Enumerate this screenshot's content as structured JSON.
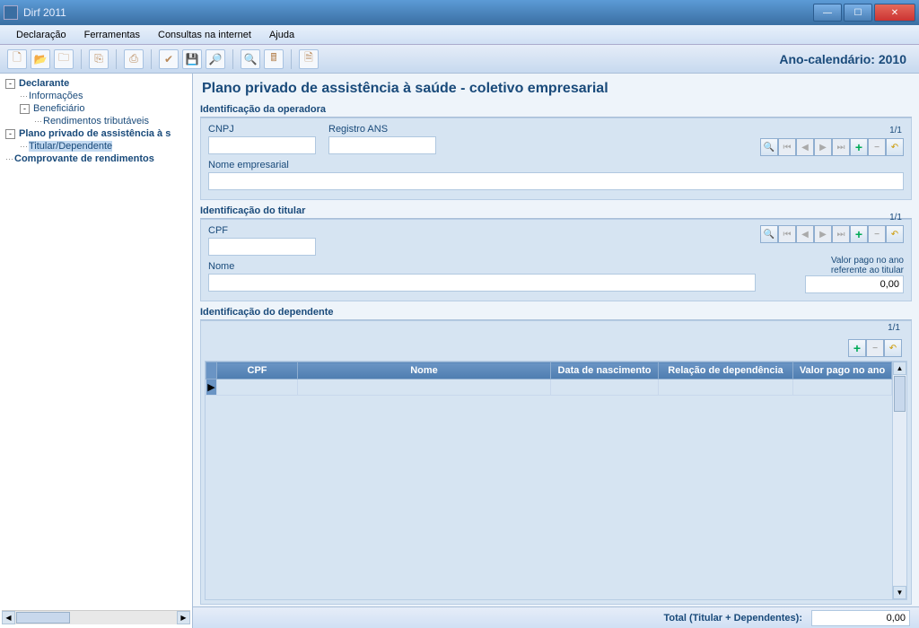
{
  "window": {
    "title": "Dirf 2011"
  },
  "menubar": [
    "Declaração",
    "Ferramentas",
    "Consultas na internet",
    "Ajuda"
  ],
  "toolbar": {
    "icons": [
      "new",
      "open",
      "folder",
      "copy",
      "print",
      "check",
      "save",
      "find",
      "zoom",
      "calc",
      "doc"
    ],
    "year_label": "Ano-calendário: 2010"
  },
  "tree": [
    {
      "level": 1,
      "label": "Declarante",
      "bold": true,
      "exp": "-"
    },
    {
      "level": 2,
      "label": "Informações",
      "bold": false
    },
    {
      "level": 2,
      "label": "Beneficiário",
      "bold": false,
      "exp": "-"
    },
    {
      "level": 3,
      "label": "Rendimentos tributáveis",
      "bold": false
    },
    {
      "level": 1,
      "label": "Plano privado de assistência à s",
      "bold": true,
      "exp": "-"
    },
    {
      "level": 2,
      "label": "Titular/Dependente",
      "bold": false,
      "selected": true
    },
    {
      "level": 1,
      "label": "Comprovante de rendimentos",
      "bold": true
    }
  ],
  "page": {
    "title": "Plano privado de assistência à saúde - coletivo empresarial"
  },
  "operadora": {
    "title": "Identificação da operadora",
    "cnpj_label": "CNPJ",
    "cnpj_value": "",
    "reg_label": "Registro ANS",
    "reg_value": "",
    "nome_label": "Nome empresarial",
    "nome_value": "",
    "count": "1/1"
  },
  "titular": {
    "title": "Identificação do titular",
    "cpf_label": "CPF",
    "cpf_value": "",
    "nome_label": "Nome",
    "nome_value": "",
    "valor_label1": "Valor pago no ano",
    "valor_label2": "referente ao titular",
    "valor_value": "0,00",
    "count": "1/1"
  },
  "dependente": {
    "title": "Identificação do dependente",
    "count": "1/1",
    "columns": [
      "CPF",
      "Nome",
      "Data de nascimento",
      "Relação de dependência",
      "Valor pago no ano"
    ]
  },
  "footer": {
    "label": "Total (Titular + Dependentes):",
    "value": "0,00"
  }
}
